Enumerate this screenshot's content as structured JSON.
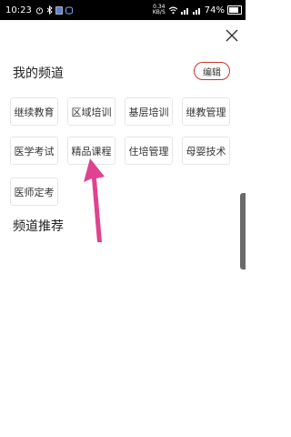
{
  "status_bar": {
    "time": "10:23",
    "speed_value": "0.34",
    "speed_unit": "KB/S",
    "battery": "74%"
  },
  "my_channels": {
    "title": "我的频道",
    "edit_label": "编辑",
    "items": [
      "继续教育",
      "区域培训",
      "基层培训",
      "继教管理",
      "医学考试",
      "精品课程",
      "住培管理",
      "母婴技术",
      "医师定考"
    ]
  },
  "recommended": {
    "title": "频道推荐"
  },
  "colors": {
    "accent": "#c0392b",
    "annotation_arrow": "#e0428f"
  }
}
